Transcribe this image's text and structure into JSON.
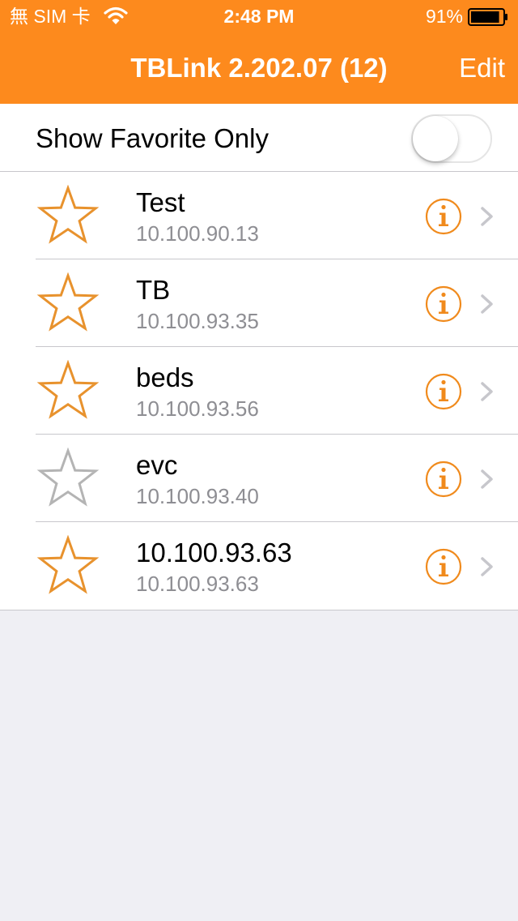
{
  "status_bar": {
    "carrier": "無 SIM 卡",
    "time": "2:48 PM",
    "battery_percent": "91%",
    "battery_level": 0.91,
    "wifi_icon": "wifi-icon",
    "battery_icon": "battery-icon"
  },
  "nav": {
    "title": "TBLink 2.202.07 (12)",
    "edit_label": "Edit"
  },
  "favorite_filter": {
    "label": "Show Favorite Only",
    "enabled": false
  },
  "devices": [
    {
      "name": "Test",
      "ip": "10.100.90.13",
      "favorite": true
    },
    {
      "name": "TB",
      "ip": "10.100.93.35",
      "favorite": true
    },
    {
      "name": "beds",
      "ip": "10.100.93.56",
      "favorite": true
    },
    {
      "name": "evc",
      "ip": "10.100.93.40",
      "favorite": false
    },
    {
      "name": "10.100.93.63",
      "ip": "10.100.93.63",
      "favorite": true
    }
  ],
  "colors": {
    "accent": "#fd8a1d",
    "star_favorite": "#e8922d",
    "star_unfavorite": "#b4b4b4",
    "info": "#f08a1c",
    "chevron": "#c7c7cc",
    "background": "#efeff4"
  },
  "icons": {
    "star": "star-icon",
    "info": "info-icon",
    "chevron": "chevron-right-icon"
  }
}
